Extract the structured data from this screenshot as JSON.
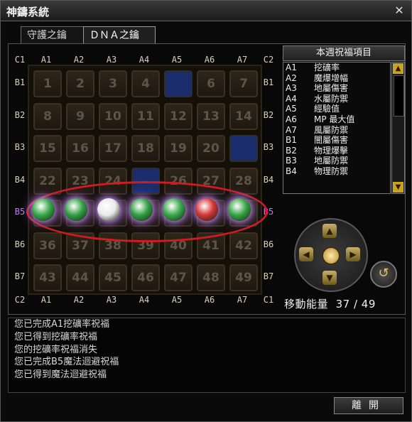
{
  "window": {
    "title": "神鑄系統",
    "close_label": "✕"
  },
  "tabs": [
    {
      "label": "守護之鑰",
      "active": false
    },
    {
      "label": "ＤＮＡ之鑰",
      "active": true
    }
  ],
  "grid": {
    "col_labels": [
      "A1",
      "A2",
      "A3",
      "A4",
      "A5",
      "A6",
      "A7"
    ],
    "row_labels": [
      "B1",
      "B2",
      "B3",
      "B4",
      "B5",
      "B6",
      "B7"
    ],
    "corner_labels": {
      "top_left": "C1",
      "top_right": "C2",
      "bottom_left": "C2",
      "bottom_right": "C1"
    },
    "cells": [
      [
        "1",
        "2",
        "3",
        "4",
        "",
        "6",
        "7"
      ],
      [
        "8",
        "9",
        "10",
        "11",
        "12",
        "13",
        "14"
      ],
      [
        "15",
        "16",
        "17",
        "18",
        "19",
        "20",
        ""
      ],
      [
        "22",
        "23",
        "24",
        "",
        "26",
        "27",
        "28"
      ],
      [
        "",
        "",
        "",
        "",
        "",
        "",
        ""
      ],
      [
        "36",
        "37",
        "38",
        "39",
        "40",
        "41",
        "42"
      ],
      [
        "43",
        "44",
        "45",
        "46",
        "47",
        "48",
        "49"
      ]
    ],
    "blue_cells": [
      [
        0,
        4
      ],
      [
        2,
        6
      ],
      [
        3,
        3
      ]
    ],
    "orb_row": 4,
    "orb_colors": [
      "#39a84a",
      "#35a046",
      "#eaeaea",
      "#33a044",
      "#3aa84b",
      "#d43636",
      "#38a448"
    ]
  },
  "weekly_list": {
    "header": "本週祝福項目",
    "items": [
      {
        "code": "A1",
        "label": "挖礦率"
      },
      {
        "code": "A2",
        "label": "魔爆增幅"
      },
      {
        "code": "A3",
        "label": "地屬傷害"
      },
      {
        "code": "A4",
        "label": "水屬防禦"
      },
      {
        "code": "A5",
        "label": "經驗值"
      },
      {
        "code": "A6",
        "label": "MP 最大值"
      },
      {
        "code": "A7",
        "label": "風屬防禦"
      },
      {
        "code": "B1",
        "label": "闇屬傷害"
      },
      {
        "code": "B2",
        "label": "物理爆擊"
      },
      {
        "code": "B3",
        "label": "地屬防禦"
      },
      {
        "code": "B4",
        "label": "物理防禦"
      }
    ]
  },
  "dpad": {
    "up": "▲",
    "down": "▼",
    "left": "◀",
    "right": "▶",
    "rotate": "↺"
  },
  "energy": {
    "label": "移動能量",
    "value": "37",
    "max": "49",
    "separator": "/"
  },
  "log": [
    "您已完成A1挖礦率祝福",
    "您已得到挖礦率祝福",
    "您的挖礦率祝福消失",
    "您已完成B5魔法迴避祝福",
    "您已得到魔法迴避祝福"
  ],
  "leave_button": "離開"
}
